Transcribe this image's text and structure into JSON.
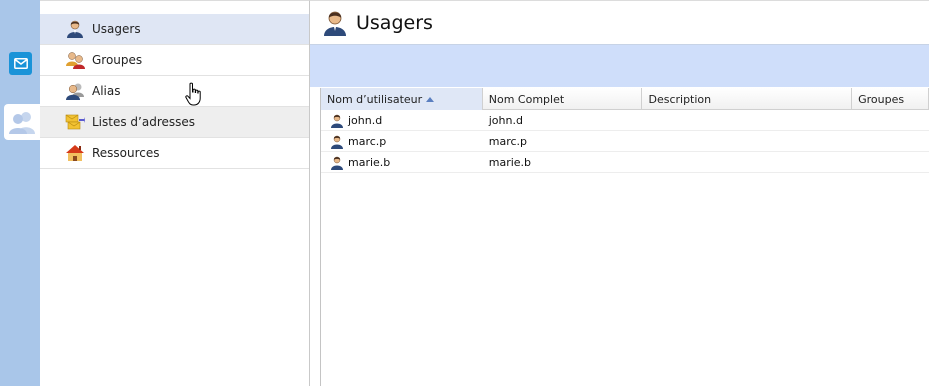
{
  "rail": {
    "items": [
      {
        "icon": "mail-icon",
        "color": "#1a93d8"
      },
      {
        "icon": "users-icon",
        "selected": true
      }
    ],
    "background": "#a9c6e9"
  },
  "nav": {
    "items": [
      {
        "label": "Usagers",
        "icon": "user-icon",
        "selected": true
      },
      {
        "label": "Groupes",
        "icon": "group-icon"
      },
      {
        "label": "Alias",
        "icon": "alias-icon"
      },
      {
        "label": "Listes d’adresses",
        "icon": "mailing-list-icon",
        "hover": true
      },
      {
        "label": "Ressources",
        "icon": "house-icon"
      }
    ]
  },
  "main": {
    "title": "Usagers",
    "toolbar_color": "#cfdefa",
    "table": {
      "columns": [
        "Nom d’utilisateur",
        "Nom Complet",
        "Description",
        "Groupes"
      ],
      "sorted_column": 0,
      "sort_direction": "ascending",
      "rows": [
        {
          "username": "john.d",
          "fullname": "john.d",
          "description": "",
          "groups": ""
        },
        {
          "username": "marc.p",
          "fullname": "marc.p",
          "description": "",
          "groups": ""
        },
        {
          "username": "marie.b",
          "fullname": "marie.b",
          "description": "",
          "groups": ""
        }
      ]
    }
  }
}
